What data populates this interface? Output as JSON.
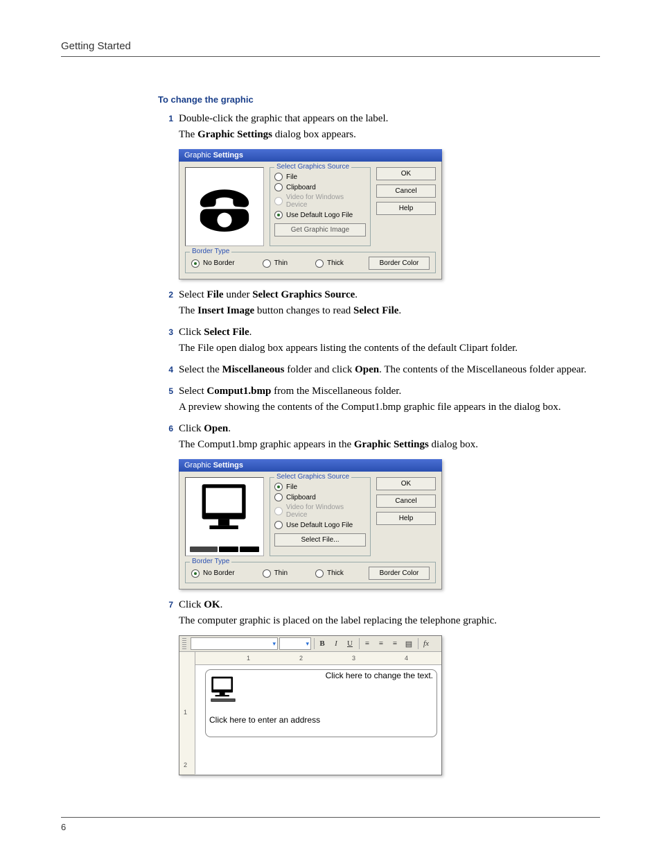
{
  "header": {
    "running": "Getting Started"
  },
  "section": {
    "title": "To change the graphic"
  },
  "steps": {
    "s1": {
      "num": "1",
      "l1a": "Double-click the graphic that appears on the label.",
      "l2a": "The ",
      "l2b": "Graphic Settings",
      "l2c": " dialog box appears."
    },
    "s2": {
      "num": "2",
      "l1a": "Select ",
      "l1b": "File",
      "l1c": " under ",
      "l1d": "Select Graphics Source",
      "l1e": ".",
      "l2a": "The ",
      "l2b": "Insert Image",
      "l2c": " button changes to read ",
      "l2d": "Select File",
      "l2e": "."
    },
    "s3": {
      "num": "3",
      "l1a": "Click ",
      "l1b": "Select File",
      "l1c": ".",
      "l2": "The File open dialog box appears listing the contents of the default Clipart folder."
    },
    "s4": {
      "num": "4",
      "l1a": "Select the ",
      "l1b": "Miscellaneous",
      "l1c": " folder and click ",
      "l1d": "Open",
      "l1e": ". The contents of the Miscellaneous folder appear."
    },
    "s5": {
      "num": "5",
      "l1a": "Select ",
      "l1b": "Comput1.bmp",
      "l1c": " from the Miscellaneous folder.",
      "l2": "A preview showing the contents of the Comput1.bmp graphic file appears in the dialog box."
    },
    "s6": {
      "num": "6",
      "l1a": "Click ",
      "l1b": "Open",
      "l1c": ".",
      "l2a": "The Comput1.bmp graphic appears in the ",
      "l2b": "Graphic Settings",
      "l2c": " dialog box."
    },
    "s7": {
      "num": "7",
      "l1a": "Click ",
      "l1b": "OK",
      "l1c": ".",
      "l2": "The computer graphic is placed on the label replacing the telephone graphic."
    }
  },
  "dialog": {
    "title_a": "Graphic ",
    "title_b": "Settings",
    "group_source": "Select Graphics Source",
    "opt_file": "File",
    "opt_clipboard": "Clipboard",
    "opt_video": "Video for Windows Device",
    "opt_default": "Use Default Logo File",
    "btn_get": "Get Graphic Image",
    "btn_select": "Select File...",
    "btn_ok": "OK",
    "btn_cancel": "Cancel",
    "btn_help": "Help",
    "group_border": "Border Type",
    "opt_noborder": "No Border",
    "opt_thin": "Thin",
    "opt_thick": "Thick",
    "btn_bordercolor": "Border Color"
  },
  "editor": {
    "ruler": {
      "r1": "1",
      "r2": "2",
      "r3": "3",
      "r4": "4",
      "v1": "1",
      "v2": "2"
    },
    "text1": "Click here to change the text.",
    "text2": "Click here to enter an address",
    "tb": {
      "b": "B",
      "i": "I",
      "u": "U",
      "fx": "fx"
    }
  },
  "footer": {
    "page": "6"
  }
}
